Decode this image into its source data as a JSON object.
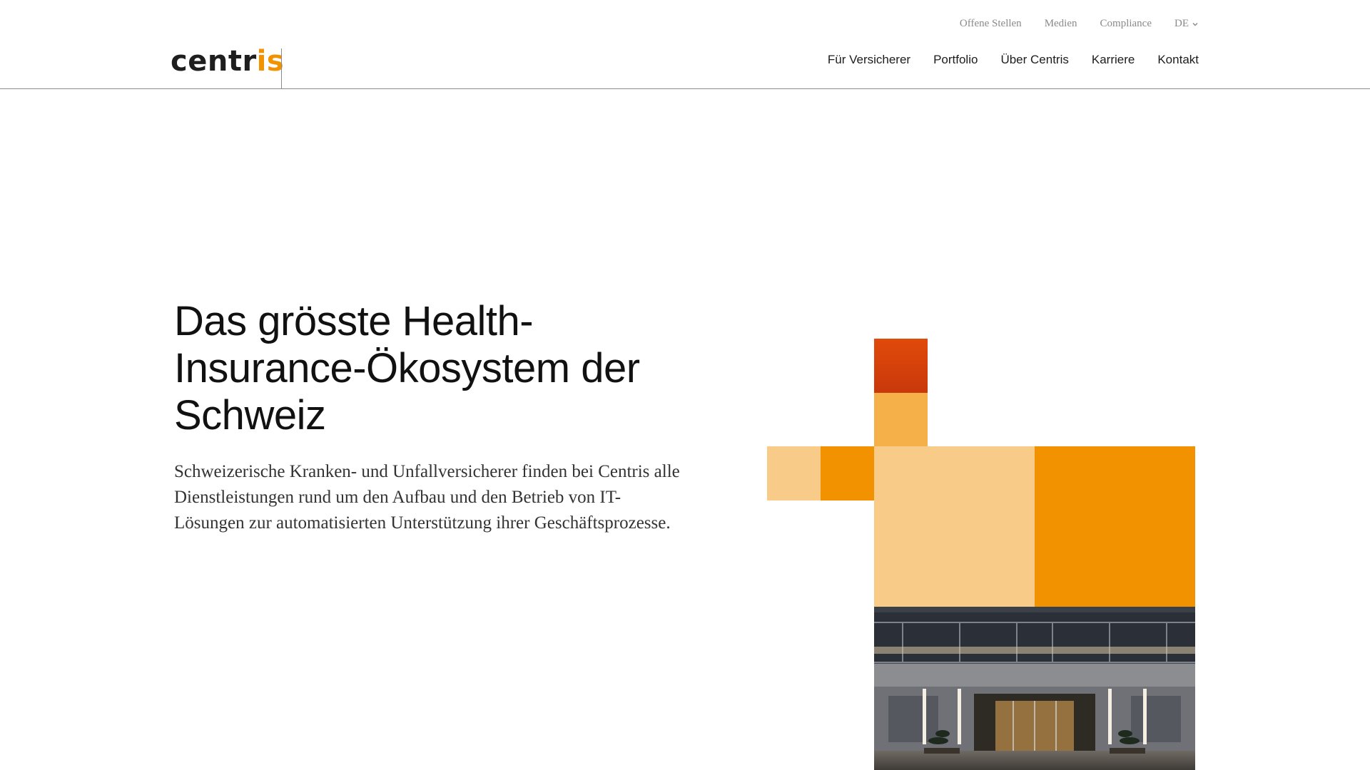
{
  "logo": {
    "prefix": "centr",
    "accent": "is",
    "accent_color": "#f39200"
  },
  "utility_nav": [
    "Offene Stellen",
    "Medien",
    "Compliance"
  ],
  "language": {
    "selected": "DE",
    "icon": "chevron-down-icon"
  },
  "main_nav": [
    "Für Versicherer",
    "Portfolio",
    "Über Centris",
    "Karriere",
    "Kontakt"
  ],
  "hero": {
    "title": "Das grösste Health-Insurance-Ökosystem der Schweiz",
    "subtitle": "Schweizerische Kranken- und Unfallversicherer finden bei Centris alle Dienstleistungen rund um den Aufbau und den Betrieb von IT-Lösungen zur automatisierten Unterstützung ihrer Geschäftsprozesse."
  },
  "colors": {
    "orange": "#f39200",
    "light_orange": "#f8cb88",
    "mid_orange": "#f6b04a",
    "red_orange": "#d9430c"
  }
}
